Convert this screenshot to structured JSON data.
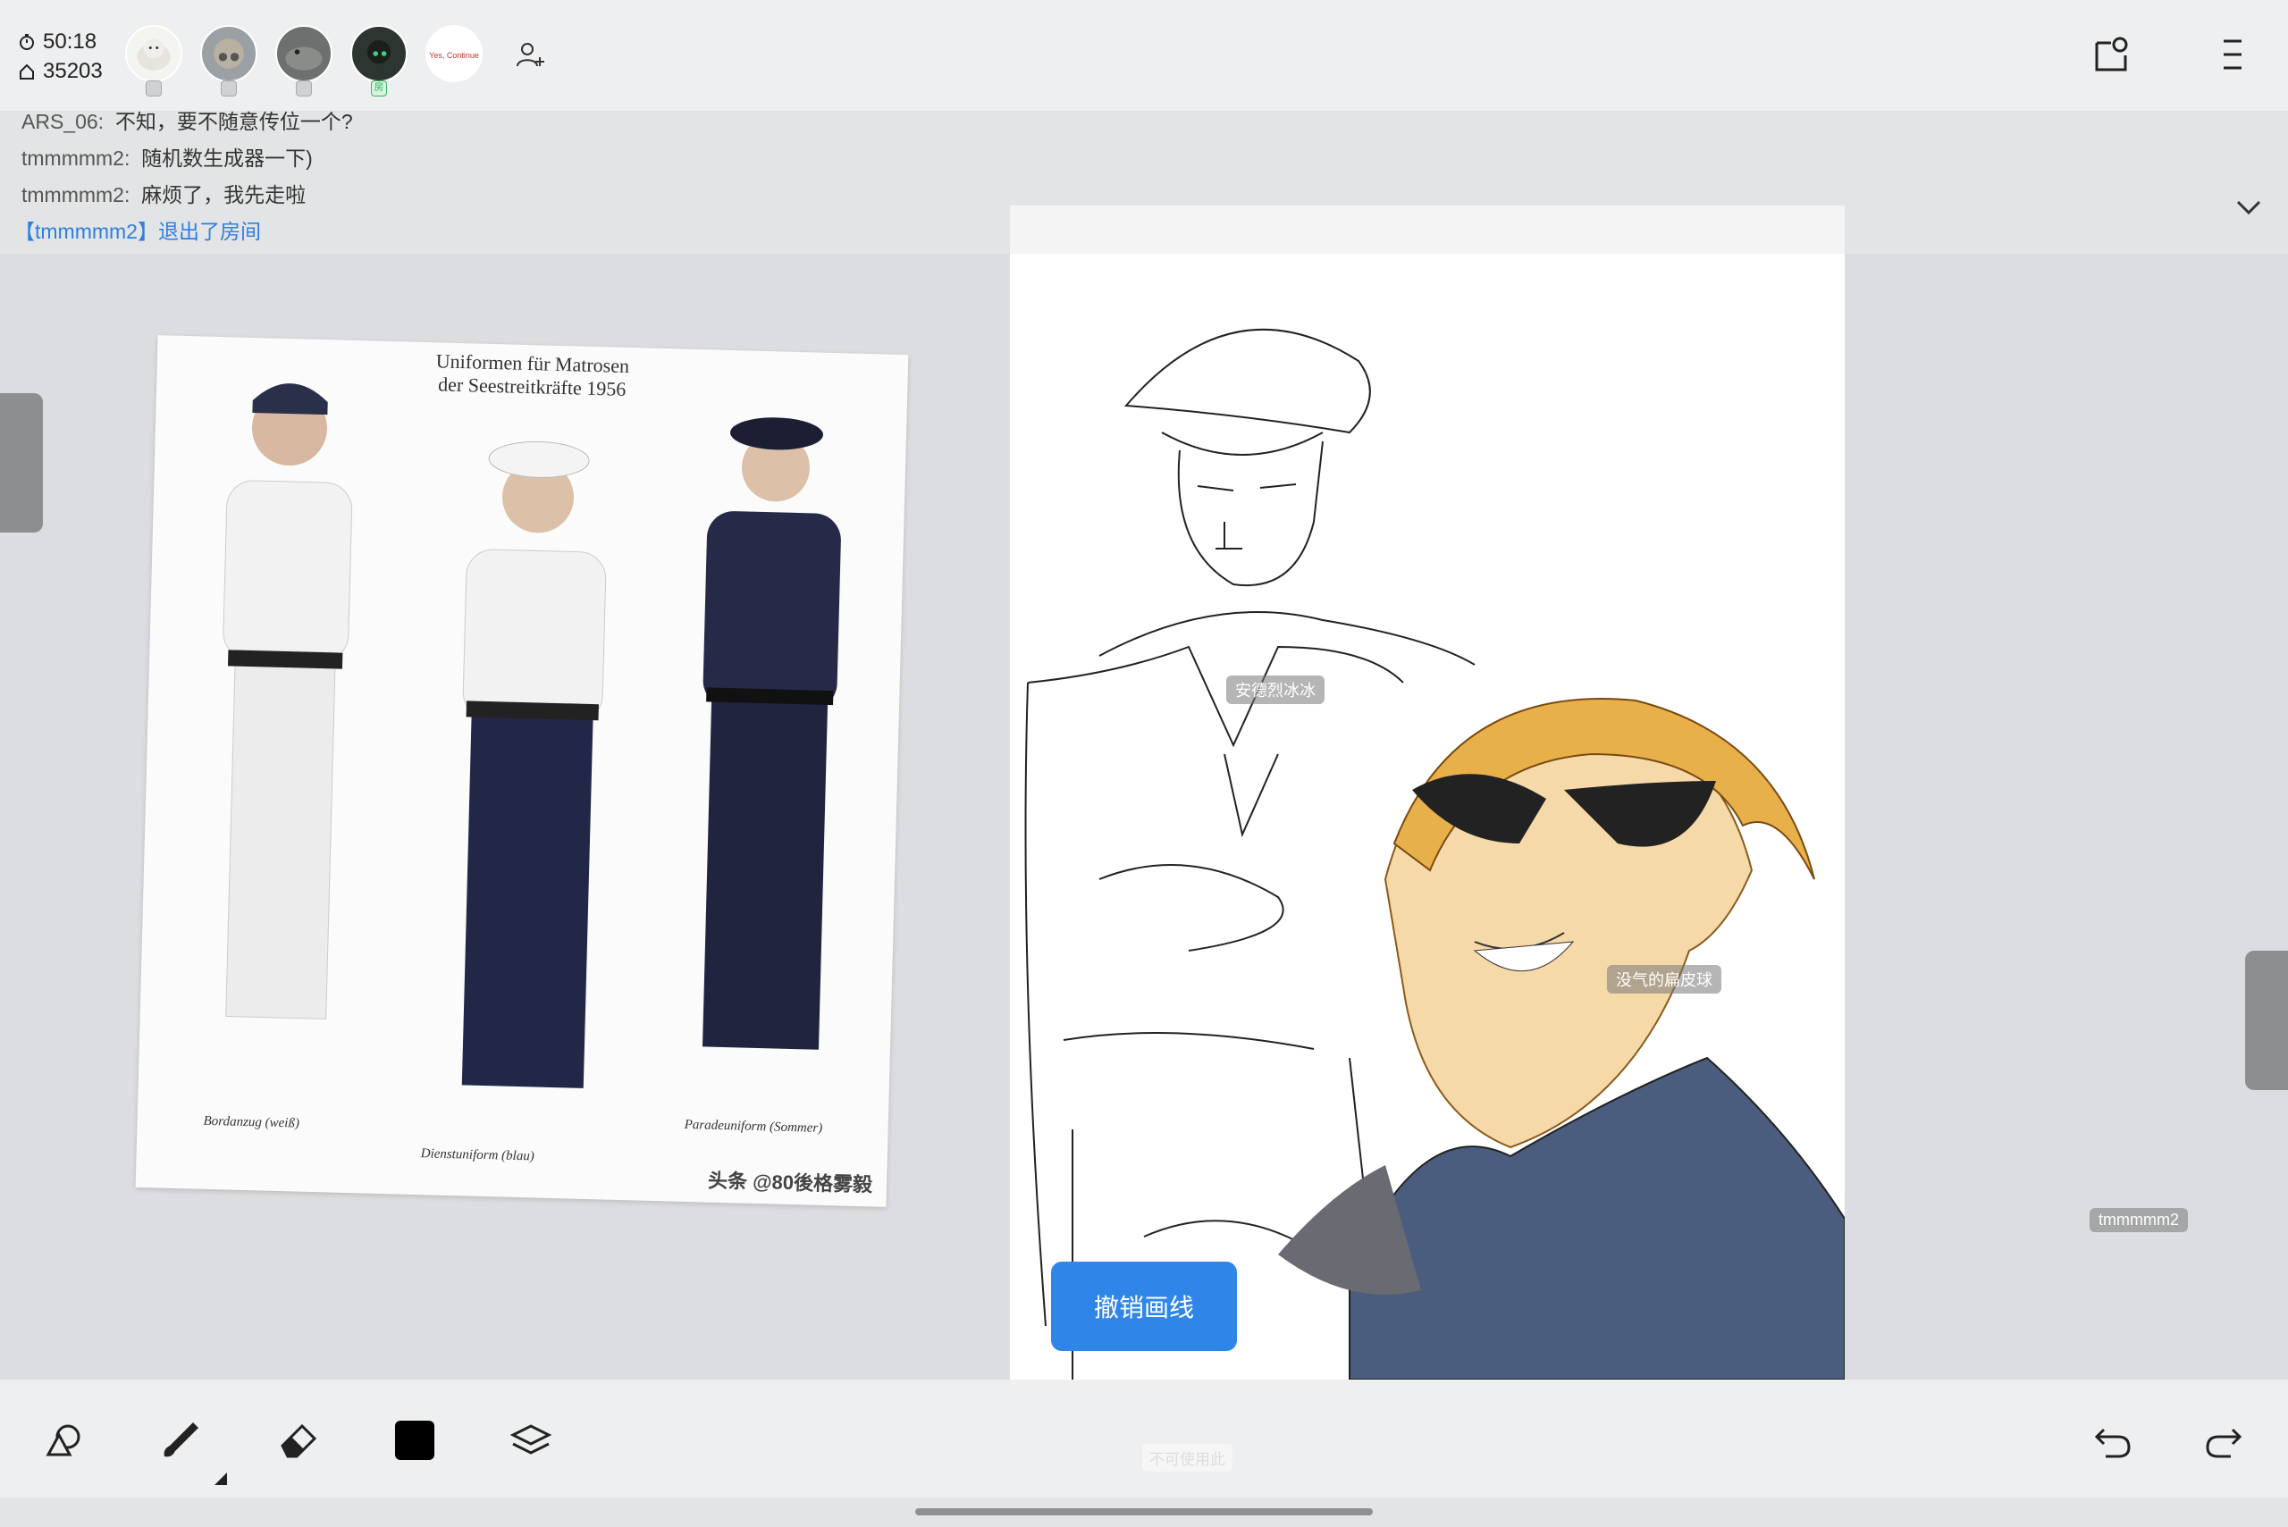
{
  "status": {
    "timer": "50:18",
    "room_id": "35203"
  },
  "avatars": [
    {
      "name": "avatar-1",
      "color": "#f2f2ee"
    },
    {
      "name": "avatar-2",
      "color": "#9aa0a4"
    },
    {
      "name": "avatar-3",
      "color": "#6e706f"
    },
    {
      "name": "avatar-4",
      "color": "#2d3530"
    },
    {
      "name": "avatar-5",
      "text": "Yes, Continue"
    }
  ],
  "chat": {
    "messages": [
      {
        "user": "ARS_06:",
        "text": "不知，要不随意传位一个?"
      },
      {
        "user": "tmmmmm2:",
        "text": "随机数生成器一下)"
      },
      {
        "user": "tmmmmm2:",
        "text": "麻烦了，我先走啦"
      }
    ],
    "system": "【tmmmmm2】退出了房间"
  },
  "reference_image": {
    "title_line1": "Uniformen für Matrosen",
    "title_line2": "der Seestreitkräfte 1956",
    "caption1": "Bordanzug (weiß)",
    "caption2": "Dienstuniform (blau)",
    "caption3": "Paradeuniform (Sommer)",
    "watermark": "头条 @80後格雾毅"
  },
  "canvas_tags": {
    "tag1": "安德烈冰冰",
    "tag2": "没气的扁皮球",
    "tag3": "tmmmmm2",
    "disabled": "不可使用此"
  },
  "undo_button": "撤销画线",
  "colors": {
    "accent": "#2f86e8",
    "current_color": "#000000"
  }
}
